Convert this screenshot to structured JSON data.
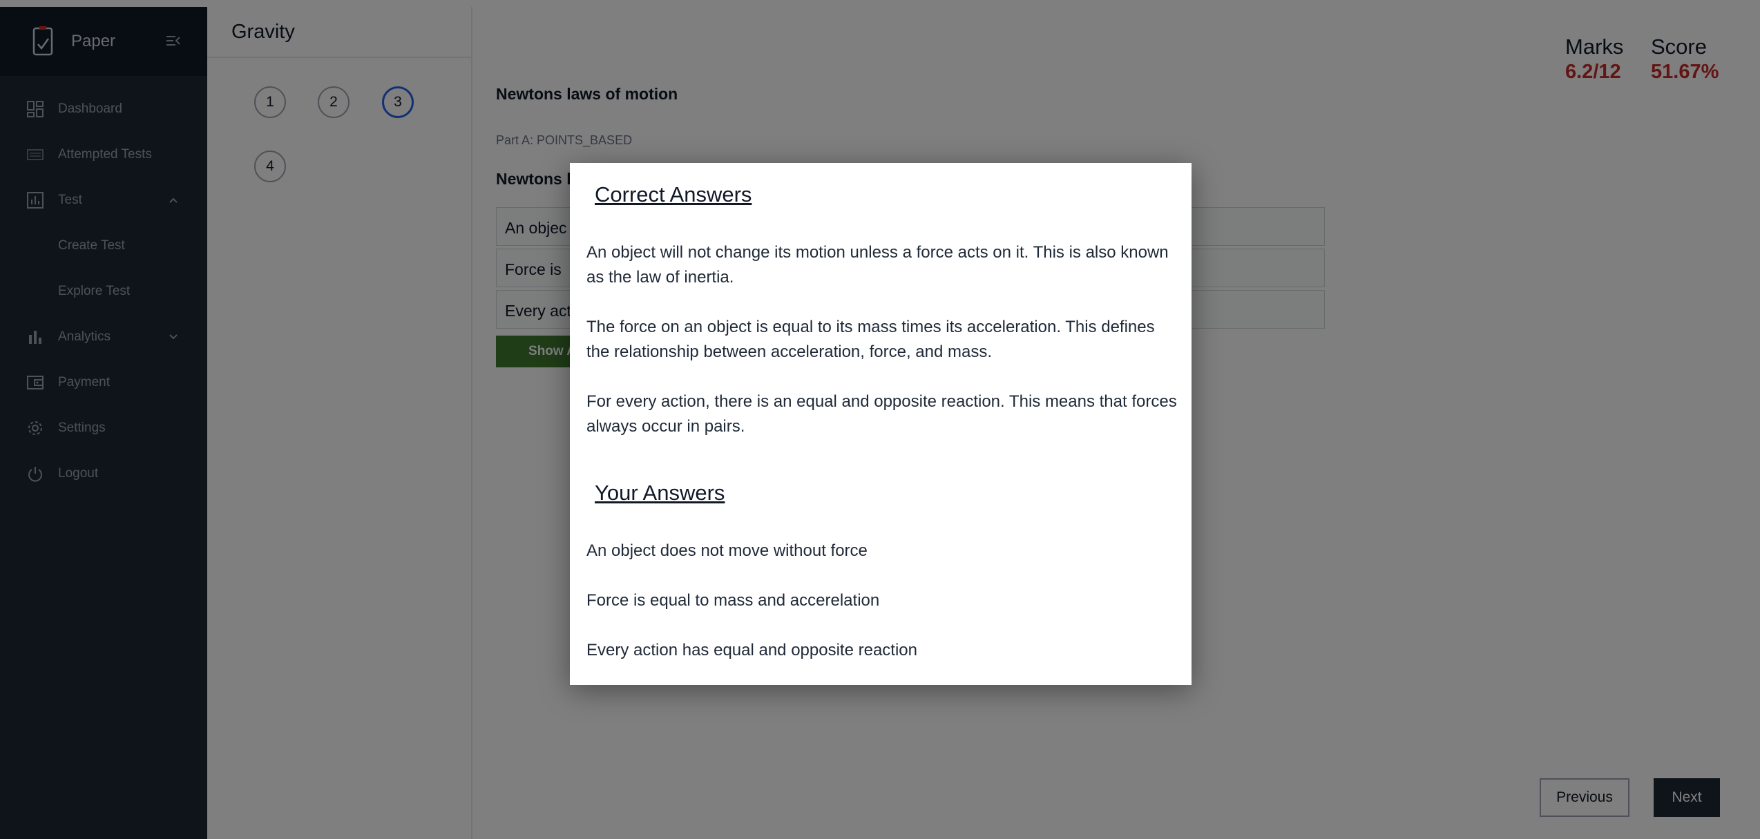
{
  "sidebar": {
    "brand": "Paper",
    "items": [
      {
        "label": "Dashboard"
      },
      {
        "label": "Attempted Tests"
      },
      {
        "label": "Test"
      },
      {
        "label": "Create Test"
      },
      {
        "label": "Explore Test"
      },
      {
        "label": "Analytics"
      },
      {
        "label": "Payment"
      },
      {
        "label": "Settings"
      },
      {
        "label": "Logout"
      }
    ]
  },
  "panel": {
    "title": "Gravity",
    "questions": [
      "1",
      "2",
      "3",
      "4"
    ],
    "active_question": "3"
  },
  "main": {
    "question_title": "Newtons laws of motion",
    "part_label": "Part A: POINTS_BASED",
    "question_sub": "Newtons l",
    "answer_rows": [
      "An objec",
      "Force is",
      "Every act"
    ],
    "show_button": "Show Answ",
    "marks_label": "Marks",
    "marks_value": "6.2/12",
    "score_label": "Score",
    "score_value": "51.67%",
    "previous": "Previous",
    "next": "Next"
  },
  "modal": {
    "correct_heading": "Correct Answers",
    "correct": [
      "An object will not change its motion unless a force acts on it. This is also known as the law of inertia.",
      "The force on an object is equal to its mass times its acceleration. This defines the relationship between acceleration, force, and mass.",
      "For every action, there is an equal and opposite reaction. This means that forces always occur in pairs."
    ],
    "yours_heading": "Your Answers",
    "yours": [
      "An object does not move without force",
      "Force is equal to mass and accerelation",
      "Every action has equal and opposite reaction"
    ]
  },
  "colors": {
    "sidebar": "#1f2937",
    "sidebar_head": "#111827",
    "score": "#c62828",
    "show_button": "#3f7a2f",
    "active_question": "#2563eb"
  }
}
